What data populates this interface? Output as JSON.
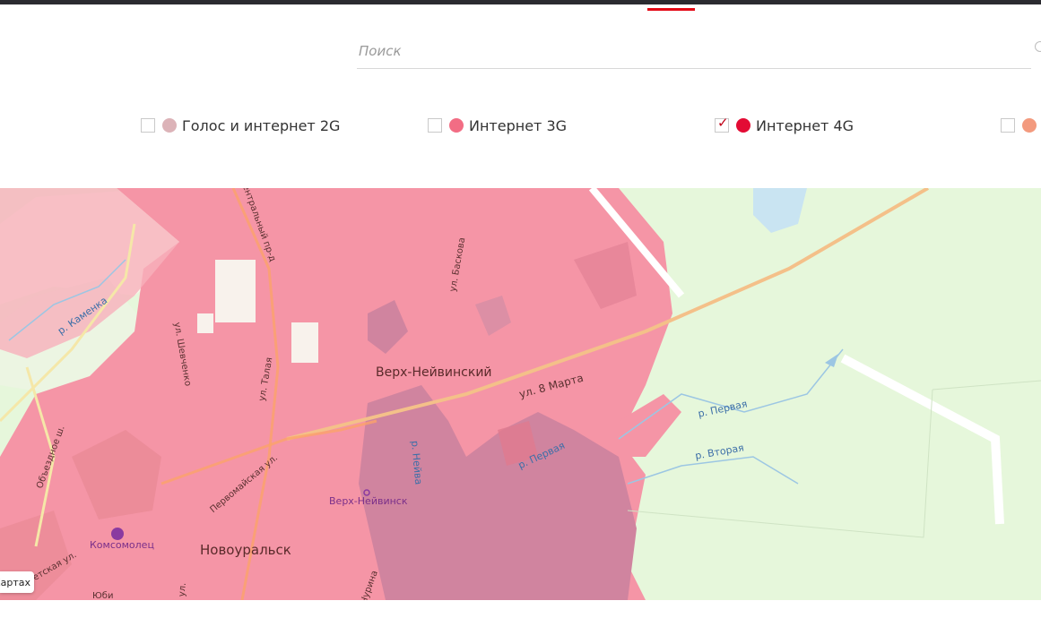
{
  "search": {
    "placeholder": "Поиск"
  },
  "legend": [
    {
      "label": "Голос и интернет 2G",
      "color": "#dcb3b8",
      "checked": false
    },
    {
      "label": "Интернет 3G",
      "color": "#f26d84",
      "checked": false
    },
    {
      "label": "Интернет 4G",
      "color": "#e30b34",
      "checked": true
    },
    {
      "label": "",
      "color": "#f39a7e",
      "checked": false
    }
  ],
  "colors": {
    "accent": "#e30613",
    "coverage": "#f595a6",
    "water_coverage": "#d0849f",
    "land": "#e6f7db"
  },
  "map": {
    "labels": {
      "city_center": "Верх-Нейвинский",
      "city_south": "Новоуральск",
      "station": "Верх-Нейвинск",
      "poi": "Комсомолец",
      "street_8marta": "ул. 8 Марта",
      "street_central": "Центральный пр-д",
      "street_shevchenko": "ул. Шевченко",
      "street_talaya": "ул. Талая",
      "street_baskova": "ул. Баскова",
      "street_pervomayskaya": "Первомайская ул.",
      "street_obezdnoe": "Объездное ш.",
      "street_sovetskaya": "етская ул.",
      "street_yubil": "Юби",
      "street_churina": "Чурина",
      "street_ul": "ул.",
      "river_kamenka": "р. Каменка",
      "river_neyva": "р. Нейва",
      "river_pervaya_1": "р. Первая",
      "river_pervaya_2": "р. Первая",
      "river_vtoraya": "р. Вторая"
    },
    "attribution": "Картах"
  }
}
